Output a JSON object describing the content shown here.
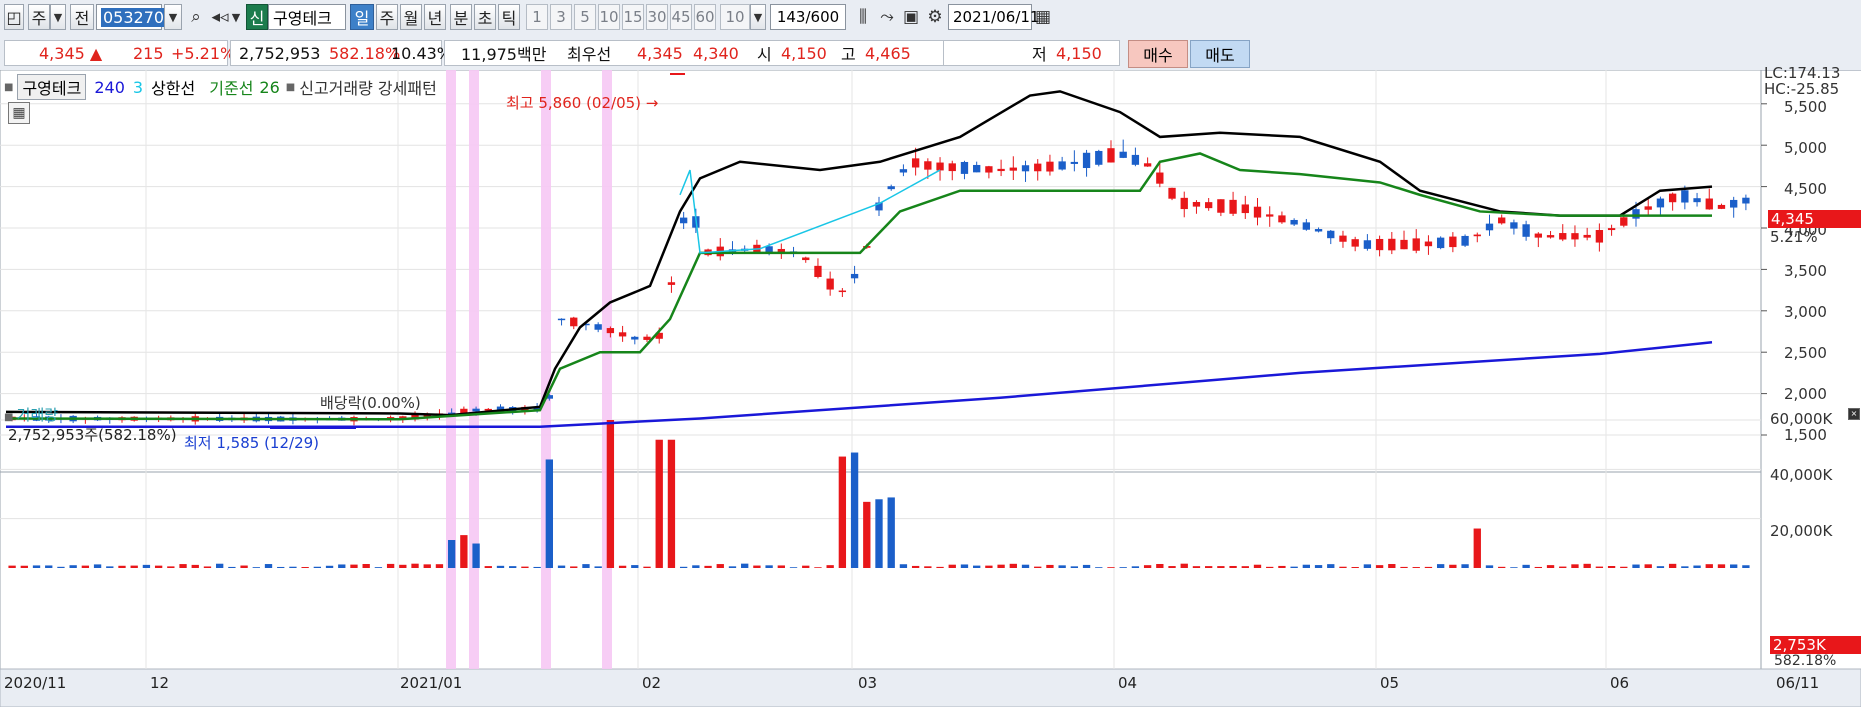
{
  "toolbar": {
    "type_value": "주",
    "prev_label": "전",
    "code_value": "053270",
    "new_label": "신",
    "stock_name": "구영테크",
    "periods": [
      "일",
      "주",
      "월",
      "년",
      "분",
      "초",
      "틱"
    ],
    "active_period": "일",
    "intervals": [
      "1",
      "3",
      "5",
      "10",
      "15",
      "30",
      "45",
      "60"
    ],
    "interval_select": "10",
    "count": "143",
    "count_max": "/600",
    "date": "2021/06/11"
  },
  "quote": {
    "price": "4,345 ▲",
    "change": "215",
    "change_pct": "+5.21%",
    "volume": "2,752,953",
    "volume_pct": "582.18%",
    "turnover": "10.43%",
    "amount": "11,975백만",
    "best_label": "최우선",
    "best_ask": "4,345",
    "best_bid": "4,340",
    "open_label": "시",
    "open": "4,150",
    "high_label": "고",
    "high": "4,465",
    "low_label": "저",
    "low": "4,150",
    "buy_label": "매수",
    "sell_label": "매도"
  },
  "legend": {
    "stock": "구영테크",
    "period1": "240",
    "period2": "3",
    "upper_line": "상한선",
    "base_line": "기준선",
    "base_period": "26",
    "pattern": "신고거래량 강세패턴"
  },
  "annotations": {
    "high_marker": "최고 5,860 (02/05) →",
    "dividend": "배당락(0.00%)",
    "low_marker": "최저 1,585 (12/29)"
  },
  "price_scale": {
    "lc": "LC:174.13",
    "hc": "HC:-25.85",
    "ticks": [
      "5,500",
      "5,000",
      "4,500",
      "4,000",
      "3,500",
      "3,000",
      "2,500",
      "2,000",
      "1,500"
    ],
    "current_tag": "4,345",
    "current_pct": "5.21%"
  },
  "volume_panel": {
    "title": "거래량",
    "value": "2,752,953주(582.18%)",
    "ticks": [
      "60,000K",
      "40,000K",
      "20,000K"
    ],
    "current_tag": "2,753K",
    "current_pct": "582.18%"
  },
  "x_axis": {
    "labels": [
      "2020/11",
      "12",
      "2021/01",
      "02",
      "03",
      "04",
      "05",
      "06"
    ],
    "end_label": "06/11"
  },
  "colors": {
    "up": "#e8171a",
    "down": "#1b5fc9",
    "ma240": "#1a18d8",
    "ma3": "#19c6e6",
    "upper": "#000000",
    "base": "#16851a",
    "highlight": "#f6c8f4"
  },
  "chart_data": {
    "type": "candlestick",
    "x_range": [
      "2020/11",
      "2021/06/11"
    ],
    "y_range": [
      1300,
      6200
    ],
    "volume_range_k": [
      0,
      60000
    ],
    "highlighted_sessions": [
      "2021/01 (early)",
      "2021/01 (early)",
      "2021/01 (late)",
      "2021/01 (late)"
    ],
    "series_names": [
      "240",
      "3",
      "상한선",
      "기준선 26"
    ]
  }
}
